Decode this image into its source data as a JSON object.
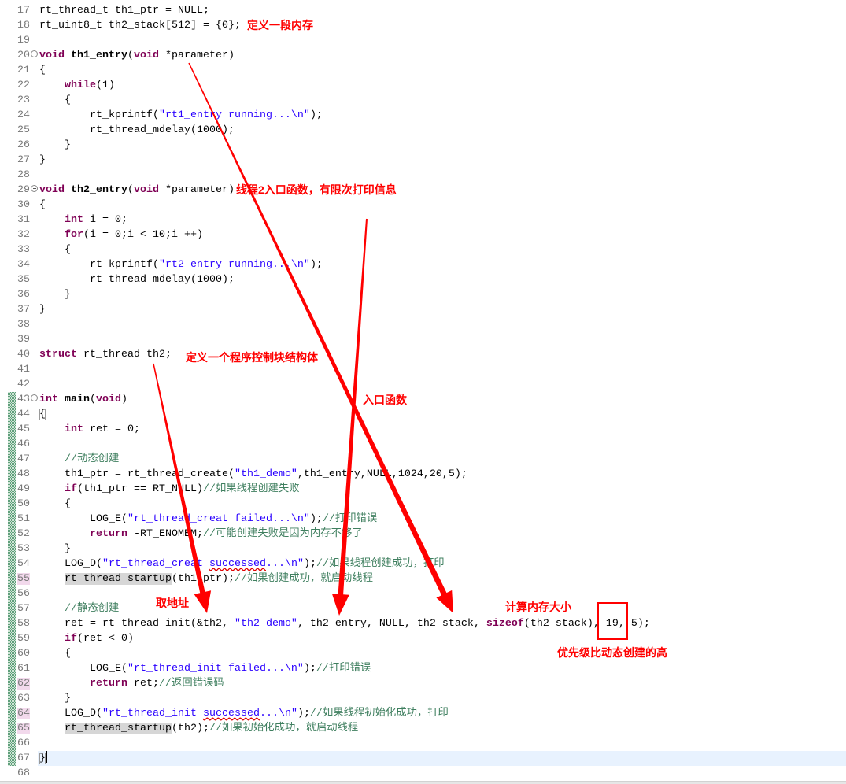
{
  "editor": {
    "lines": [
      {
        "n": "17",
        "tokens": [
          {
            "txt": "rt_thread_t th1_ptr = NULL;"
          }
        ]
      },
      {
        "n": "18",
        "tokens": [
          {
            "txt": "rt_uint8_t th2_stack[512] = {0};"
          }
        ]
      },
      {
        "n": "19",
        "tokens": []
      },
      {
        "n": "20",
        "fold": true,
        "tokens": [
          {
            "kw": "void"
          },
          {
            "txt": " "
          },
          {
            "fn": "th1_entry"
          },
          {
            "txt": "("
          },
          {
            "kw": "void"
          },
          {
            "txt": " *parameter)"
          }
        ]
      },
      {
        "n": "21",
        "tokens": [
          {
            "txt": "{"
          }
        ]
      },
      {
        "n": "22",
        "tokens": [
          {
            "txt": "    "
          },
          {
            "kw": "while"
          },
          {
            "txt": "(1)"
          }
        ]
      },
      {
        "n": "23",
        "tokens": [
          {
            "txt": "    {"
          }
        ]
      },
      {
        "n": "24",
        "tokens": [
          {
            "txt": "        rt_kprintf("
          },
          {
            "str": "\"rt1_entry running...\\n\""
          },
          {
            "txt": ");"
          }
        ]
      },
      {
        "n": "25",
        "tokens": [
          {
            "txt": "        rt_thread_mdelay(1000);"
          }
        ]
      },
      {
        "n": "26",
        "tokens": [
          {
            "txt": "    }"
          }
        ]
      },
      {
        "n": "27",
        "tokens": [
          {
            "txt": "}"
          }
        ]
      },
      {
        "n": "28",
        "tokens": []
      },
      {
        "n": "29",
        "fold": true,
        "tokens": [
          {
            "kw": "void"
          },
          {
            "txt": " "
          },
          {
            "fn": "th2_entry"
          },
          {
            "txt": "("
          },
          {
            "kw": "void"
          },
          {
            "txt": " *parameter)"
          }
        ]
      },
      {
        "n": "30",
        "tokens": [
          {
            "txt": "{"
          }
        ]
      },
      {
        "n": "31",
        "tokens": [
          {
            "txt": "    "
          },
          {
            "kw": "int"
          },
          {
            "txt": " i = 0;"
          }
        ]
      },
      {
        "n": "32",
        "tokens": [
          {
            "txt": "    "
          },
          {
            "kw": "for"
          },
          {
            "txt": "(i = 0;i < 10;i ++)"
          }
        ]
      },
      {
        "n": "33",
        "tokens": [
          {
            "txt": "    {"
          }
        ]
      },
      {
        "n": "34",
        "tokens": [
          {
            "txt": "        rt_kprintf("
          },
          {
            "str": "\"rt2_entry running...\\n\""
          },
          {
            "txt": ");"
          }
        ]
      },
      {
        "n": "35",
        "tokens": [
          {
            "txt": "        rt_thread_mdelay(1000);"
          }
        ]
      },
      {
        "n": "36",
        "tokens": [
          {
            "txt": "    }"
          }
        ]
      },
      {
        "n": "37",
        "tokens": [
          {
            "txt": "}"
          }
        ]
      },
      {
        "n": "38",
        "tokens": []
      },
      {
        "n": "39",
        "tokens": []
      },
      {
        "n": "40",
        "tokens": [
          {
            "kw": "struct"
          },
          {
            "txt": " rt_thread th2;"
          }
        ]
      },
      {
        "n": "41",
        "tokens": []
      },
      {
        "n": "42",
        "tokens": []
      },
      {
        "n": "43",
        "fold": true,
        "tokens": [
          {
            "kw": "int"
          },
          {
            "txt": " "
          },
          {
            "fn": "main"
          },
          {
            "txt": "("
          },
          {
            "kw": "void"
          },
          {
            "txt": ")"
          }
        ]
      },
      {
        "n": "44",
        "tokens": [
          {
            "brace": "{"
          }
        ]
      },
      {
        "n": "45",
        "tokens": [
          {
            "txt": "    "
          },
          {
            "kw": "int"
          },
          {
            "txt": " ret = 0;"
          }
        ]
      },
      {
        "n": "46",
        "tokens": []
      },
      {
        "n": "47",
        "tokens": [
          {
            "txt": "    "
          },
          {
            "cmt": "//动态创建"
          }
        ]
      },
      {
        "n": "48",
        "tokens": [
          {
            "txt": "    th1_ptr = rt_thread_create("
          },
          {
            "str": "\"th1_demo\""
          },
          {
            "txt": ",th1_entry,NULL,1024,20,5);"
          }
        ]
      },
      {
        "n": "49",
        "tokens": [
          {
            "txt": "    "
          },
          {
            "kw": "if"
          },
          {
            "txt": "(th1_ptr == RT_NULL)"
          },
          {
            "cmt": "//如果线程创建失败"
          }
        ]
      },
      {
        "n": "50",
        "tokens": [
          {
            "txt": "    {"
          }
        ]
      },
      {
        "n": "51",
        "tokens": [
          {
            "txt": "        LOG_E("
          },
          {
            "str": "\"rt_thread_creat failed...\\n\""
          },
          {
            "txt": ");"
          },
          {
            "cmt": "//打印错误"
          }
        ]
      },
      {
        "n": "52",
        "tokens": [
          {
            "txt": "        "
          },
          {
            "kw": "return"
          },
          {
            "txt": " -RT_ENOMEM;"
          },
          {
            "cmt": "//可能创建失败是因为内存不够了"
          }
        ]
      },
      {
        "n": "53",
        "tokens": [
          {
            "txt": "    }"
          }
        ]
      },
      {
        "n": "54",
        "tokens": [
          {
            "txt": "    LOG_D("
          },
          {
            "str": "\"rt_thread_creat "
          },
          {
            "spell": "successed"
          },
          {
            "str": "...\\n\""
          },
          {
            "txt": ");"
          },
          {
            "cmt": "//如果线程创建成功，打印"
          }
        ]
      },
      {
        "n": "55",
        "changed": true,
        "tokens": [
          {
            "txt": "    "
          },
          {
            "occ": "rt_thread_startup"
          },
          {
            "txt": "(th1_ptr);"
          },
          {
            "cmt": "//如果创建成功，就启动线程"
          }
        ]
      },
      {
        "n": "56",
        "tokens": []
      },
      {
        "n": "57",
        "tokens": [
          {
            "txt": "    "
          },
          {
            "cmt": "//静态创建"
          }
        ]
      },
      {
        "n": "58",
        "tokens": [
          {
            "txt": "    ret = rt_thread_init(&th2, "
          },
          {
            "str": "\"th2_demo\""
          },
          {
            "txt": ", th2_entry, NULL, th2_stack, "
          },
          {
            "kw": "sizeof"
          },
          {
            "txt": "(th2_stack), 19, 5);"
          }
        ]
      },
      {
        "n": "59",
        "tokens": [
          {
            "txt": "    "
          },
          {
            "kw": "if"
          },
          {
            "txt": "(ret < 0)"
          }
        ]
      },
      {
        "n": "60",
        "tokens": [
          {
            "txt": "    {"
          }
        ]
      },
      {
        "n": "61",
        "tokens": [
          {
            "txt": "        LOG_E("
          },
          {
            "str": "\"rt_thread_init failed...\\n\""
          },
          {
            "txt": ");"
          },
          {
            "cmt": "//打印错误"
          }
        ]
      },
      {
        "n": "62",
        "changed": true,
        "tokens": [
          {
            "txt": "        "
          },
          {
            "kw": "return"
          },
          {
            "txt": " ret;"
          },
          {
            "cmt": "//返回错误码"
          }
        ]
      },
      {
        "n": "63",
        "tokens": [
          {
            "txt": "    }"
          }
        ]
      },
      {
        "n": "64",
        "changed": true,
        "tokens": [
          {
            "txt": "    LOG_D("
          },
          {
            "str": "\"rt_thread_init "
          },
          {
            "spell": "successed"
          },
          {
            "str": "...\\n\""
          },
          {
            "txt": ");"
          },
          {
            "cmt": "//如果线程初始化成功，打印"
          }
        ]
      },
      {
        "n": "65",
        "changed": true,
        "tokens": [
          {
            "txt": "    "
          },
          {
            "occ": "rt_thread_startup"
          },
          {
            "txt": "(th2);"
          },
          {
            "cmt": "//如果初始化成功，就启动线程"
          }
        ]
      },
      {
        "n": "66",
        "tokens": []
      },
      {
        "n": "67",
        "current": true,
        "tokens": [
          {
            "brace": "}"
          }
        ]
      },
      {
        "n": "68",
        "tokens": []
      }
    ]
  },
  "annotations": {
    "define_memory": "定义一段内存",
    "th2_entry_desc": "线程2入口函数，有限次打印信息",
    "define_tcb": "定义一个程序控制块结构体",
    "entry_func": "入口函数",
    "take_address": "取地址",
    "calc_mem_size": "计算内存大小",
    "priority_higher": "优先级比动态创建的高"
  },
  "colors": {
    "keyword": "#7F0055",
    "string": "#2A00FF",
    "comment": "#3F7F5F",
    "annotation": "#FF0000",
    "current_line": "#E8F2FE",
    "occurrence": "#D6D6D6"
  }
}
